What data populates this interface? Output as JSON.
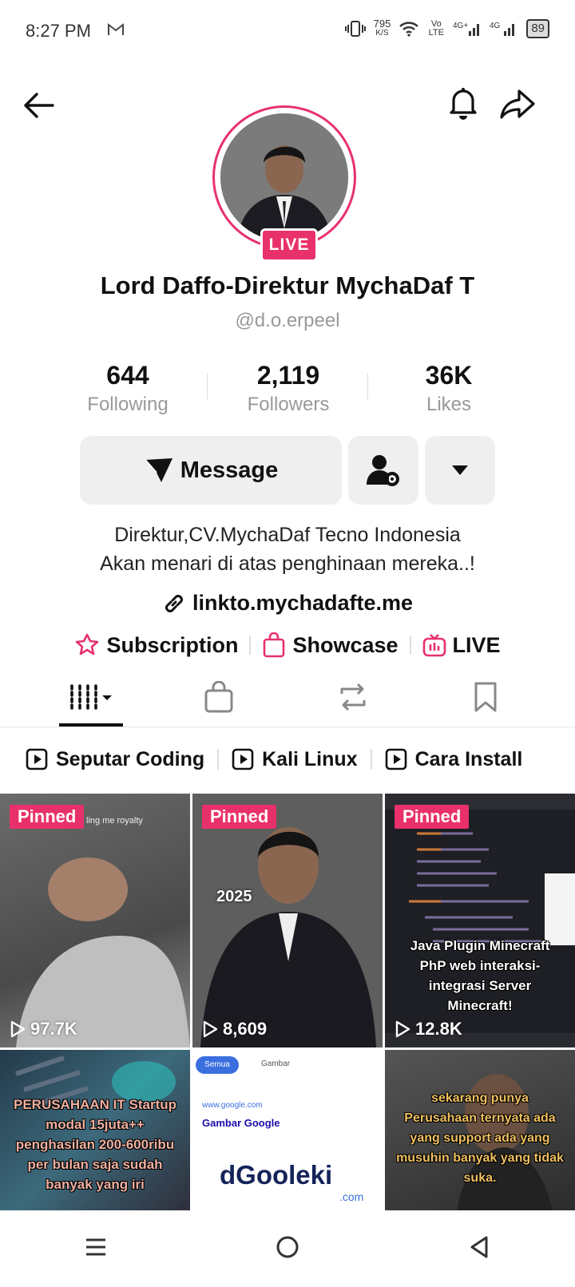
{
  "status_bar": {
    "time": "8:27 PM",
    "net_speed": "795",
    "net_unit": "K/S",
    "volte": "Vo LTE",
    "battery": "89"
  },
  "profile": {
    "live_badge": "LIVE",
    "name": "Lord Daffo-Direktur MychaDaf T",
    "handle": "@d.o.erpeel",
    "accent_color": "#e8316b"
  },
  "stats": [
    {
      "num": "644",
      "label": "Following"
    },
    {
      "num": "2,119",
      "label": "Followers"
    },
    {
      "num": "36K",
      "label": "Likes"
    }
  ],
  "actions": {
    "message_label": "Message"
  },
  "bio": {
    "line1": "Direktur,CV.MychaDaf Tecno Indonesia",
    "line2": "Akan menari di atas penghinaan mereka..!",
    "link": "linkto.mychadafte.me"
  },
  "features": {
    "subscription": "Subscription",
    "showcase": "Showcase",
    "live": "LIVE"
  },
  "playlists": [
    "Seputar Coding",
    "Kali Linux",
    "Cara Install"
  ],
  "videos": [
    {
      "pinned": "Pinned",
      "views": "97.7K",
      "overlay": "ling me royalty"
    },
    {
      "pinned": "Pinned",
      "views": "8,609",
      "overlay": "2025"
    },
    {
      "pinned": "Pinned",
      "views": "12.8K",
      "overlay": "Java Plugin Minecraft PhP web interaksi-integrasi Server Minecraft!"
    },
    {
      "overlay": "PERUSAHAAN IT Startup modal 15juta++ penghasilan 200-600ribu per bulan saja sudah banyak yang iri"
    },
    {
      "overlay": "dGooleki",
      "tab1": "Semua",
      "tab2": "Gambar",
      "site": "www.google.com",
      "heading": "Gambar Google",
      "suffix": ".com"
    },
    {
      "overlay": "sekarang punya Perusahaan ternyata ada yang support ada yang musuhin banyak yang tidak suka."
    }
  ]
}
